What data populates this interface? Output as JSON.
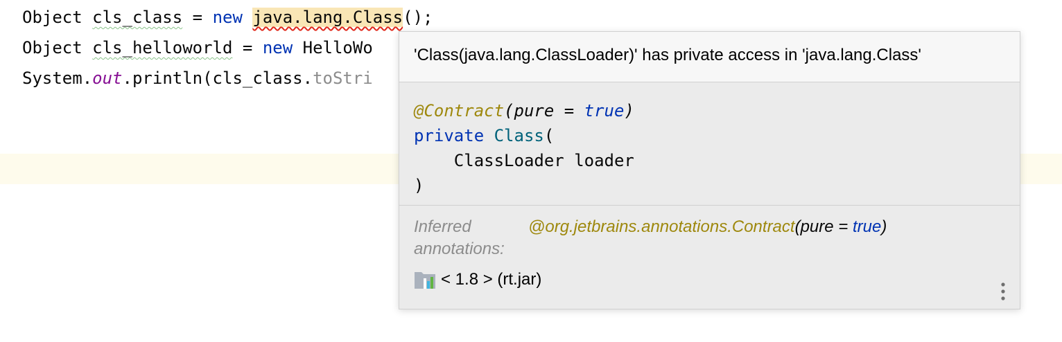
{
  "editor": {
    "line1": {
      "type": "Object",
      "var": "cls_class",
      "assign": "=",
      "kw": "new",
      "cls": "java.lang.Class",
      "rest": "();"
    },
    "line2": {
      "type": "Object",
      "var": "cls_helloworld",
      "assign": "=",
      "kw": "new",
      "cls": "HelloWo"
    },
    "line3": {
      "prefix": "System.",
      "field": "out",
      "call": ".println(cls_class.",
      "method": "toStri"
    }
  },
  "popup": {
    "error_message": "'Class(java.lang.ClassLoader)' has private access in 'java.lang.Class'",
    "signature": {
      "annotation": "@Contract",
      "anno_open": "(",
      "anno_param": "pure",
      "anno_eq": " = ",
      "anno_value": "true",
      "anno_close": ")",
      "modifier": "private",
      "class_name": "Class",
      "open_paren": "(",
      "param": "    ClassLoader loader",
      "close_paren": ")"
    },
    "inferred_label": "Inferred annotations:",
    "inferred_annotation": "@org.jetbrains.annotations.Contract",
    "inferred_open": "(pure = ",
    "inferred_value": "true",
    "inferred_close": ")",
    "library_icon": "library-jar-icon",
    "library_text": "< 1.8 > (rt.jar)",
    "more_icon": "more-vertical-icon"
  },
  "colors": {
    "keyword": "#0033b3",
    "annotation": "#9e880d",
    "static_field": "#871094",
    "class_name": "#00627a",
    "error_underline": "#e0281b",
    "highlight": "#f9e6b6"
  }
}
